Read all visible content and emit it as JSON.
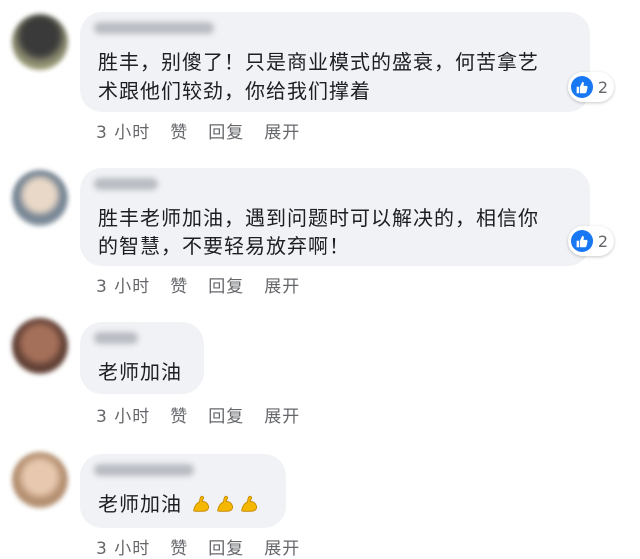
{
  "comments": [
    {
      "text_lines": [
        "胜丰，别傻了！只是商业模式的盛衰，何苦拿艺",
        "术跟他们较劲，你给我们撑着"
      ],
      "reactions": {
        "icon": "thumbs-up-icon",
        "count": "2"
      },
      "actions": {
        "time": "3 小时",
        "like": "赞",
        "reply": "回复",
        "expand": "展开"
      }
    },
    {
      "text_lines": [
        "胜丰老师加油，遇到问题时可以解决的，相信你",
        "的智慧，不要轻易放弃啊！"
      ],
      "reactions": {
        "icon": "thumbs-up-icon",
        "count": "2"
      },
      "actions": {
        "time": "3 小时",
        "like": "赞",
        "reply": "回复",
        "expand": "展开"
      }
    },
    {
      "text_lines": [
        "老师加油"
      ],
      "actions": {
        "time": "3 小时",
        "like": "赞",
        "reply": "回复",
        "expand": "展开"
      }
    },
    {
      "text_lines": [
        "老师加油"
      ],
      "emojis": [
        "flexed-biceps-icon",
        "flexed-biceps-icon",
        "flexed-biceps-icon"
      ],
      "actions": {
        "time": "3 小时",
        "like": "赞",
        "reply": "回复",
        "expand": "展开"
      }
    }
  ],
  "colors": {
    "bubble": "#f0f2f5",
    "like_blue": "#1877f2",
    "meta_text": "#65676b",
    "emoji_yellow": "#f5b700"
  }
}
